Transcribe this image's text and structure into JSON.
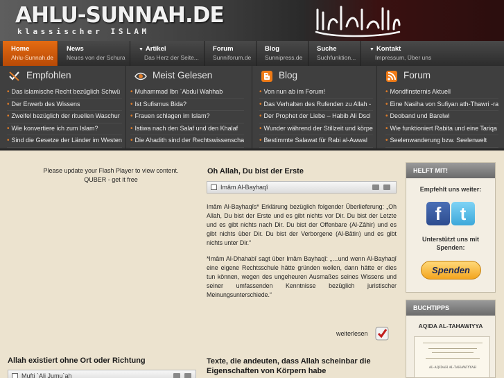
{
  "header": {
    "site_title": "AHLU-SUNNAH.DE",
    "tagline": "klassischer ISLAM"
  },
  "nav": [
    {
      "label": "Home",
      "sub": "Ahlu-Sunnah.de",
      "active": true,
      "dropdown": false
    },
    {
      "label": "News",
      "sub": "Neues von der Schura",
      "active": false,
      "dropdown": false
    },
    {
      "label": "Artikel",
      "sub": "Das Herz der Seite...",
      "active": false,
      "dropdown": true
    },
    {
      "label": "Forum",
      "sub": "Sunniforum.de",
      "active": false,
      "dropdown": false
    },
    {
      "label": "Blog",
      "sub": "Sunnipress.de",
      "active": false,
      "dropdown": false
    },
    {
      "label": "Suche",
      "sub": "Suchfunktion...",
      "active": false,
      "dropdown": false
    },
    {
      "label": "Kontakt",
      "sub": "Impressum, Über uns",
      "active": false,
      "dropdown": true
    }
  ],
  "panel": {
    "columns": [
      {
        "title": "Empfohlen",
        "icon": "thumbs-icon",
        "items": [
          "Das islamische Recht bezüglich Schwü",
          "Der Erwerb des Wissens",
          "Zweifel bezüglich der rituellen Waschur",
          "Wie konvertiere ich zum Islam?",
          "Sind die Gesetze der Länder im Westen"
        ]
      },
      {
        "title": "Meist Gelesen",
        "icon": "eye-icon",
        "items": [
          "Muhammad Ibn `Abdul Wahhab",
          "Ist Sufismus Bida?",
          "Frauen schlagen im Islam?",
          "Istiwa nach den Salaf und den Khalaf",
          "Die Ahadith sind der Rechtswissenscha"
        ]
      },
      {
        "title": "Blog",
        "icon": "blogger-icon",
        "items": [
          "Von nun ab im Forum!",
          "Das Verhalten des Rufenden zu Allah -",
          "Der Prophet der Liebe – Habib Ali Dscl",
          "Wunder während der Stillzeit und körpe",
          "Bestimmte Salawat für Rabi al-Awwal"
        ]
      },
      {
        "title": "Forum",
        "icon": "rss-icon",
        "items": [
          "Mondfinsternis Aktuell",
          "Eine Nasiha von Sufiyan ath-Thawri -ra",
          "Deoband und Barelwi",
          "Wie funktioniert Rabita und eine Tariqa",
          "Seelenwanderung bzw. Seelenwelt"
        ]
      }
    ]
  },
  "flash": {
    "line1": "Please update your Flash Player to view content.",
    "line2": "QUBER - get it free"
  },
  "article1": {
    "title": "Oh Allah, Du bist der Erste",
    "author": "Imâm Al-Bayhaqî",
    "paragraph1": "Imâm Al-Bayhaqîs* Erklärung bezüglich folgender Überlieferung: „Oh Allah, Du bist der Erste und es gibt nichts vor Dir. Du bist der Letzte und es gibt nichts nach Dir. Du bist der Offenbare (Al-Zâhir) und es gibt nichts über Dir. Du bist der Verborgene (Al-Bâtin) und es gibt nichts unter Dir.“",
    "paragraph2": "*Imâm Al-Dhahabî sagt über Imâm Bayhaqî: „…und wenn Al-Bayhaqî eine eigene Rechtsschule hätte gründen wollen, dann hätte er dies tun können, wegen des ungeheuren Ausmaßes seines Wissens und seiner umfassenden Kenntnisse bezüglich juristischer Meinungsunterschiede.“",
    "read_more": "weiterlesen"
  },
  "article2": {
    "title": "Allah existiert ohne Ort oder Richtung",
    "author": "Mufti `Ali Jumu`ah"
  },
  "article3": {
    "title_line1": "Texte, die andeuten, dass Allah scheinbar die",
    "title_line2": "Eigenschaften von Körpern habe"
  },
  "sidebar": {
    "help_title": "HELFT MIT!",
    "recommend_text": "Empfehlt uns weiter:",
    "support_line1": "Unterstützt uns mit",
    "support_line2": "Spenden:",
    "donate_label": "Spenden",
    "booktips_title": "BUCHTIPPS",
    "book_title": "AQIDA AL-TAHAWIYYA",
    "book_cover_text": "AL-AQIDAH AL-TAHAWIYYAH"
  },
  "colors": {
    "active_nav": "#d9600c",
    "panel_bg": "#3f3f3f",
    "bullet": "#e07d2a",
    "page_bg": "#ece3cf"
  }
}
